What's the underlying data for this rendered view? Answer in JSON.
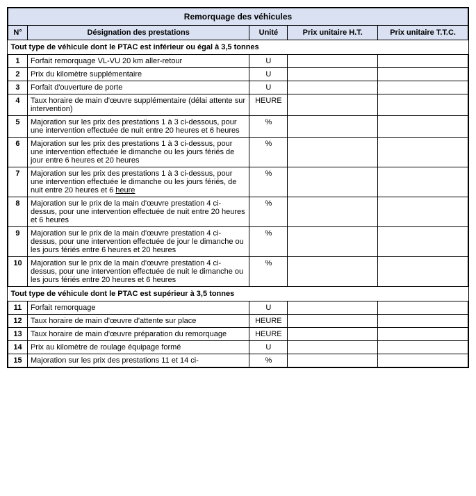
{
  "title": "Remorquage des véhicules",
  "columns": {
    "num": "N°",
    "designation": "Désignation des prestations",
    "unite": "Unité",
    "ht": "Prix unitaire H.T.",
    "ttc": "Prix unitaire T.T.C."
  },
  "section1": "Tout type de véhicule dont le PTAC est inférieur ou égal à 3,5 tonnes",
  "section2": "Tout type de véhicule dont le PTAC est supérieur à 3,5 tonnes",
  "rows": [
    {
      "num": "1",
      "desc": "Forfait remorquage VL-VU 20 km aller-retour",
      "unit": "U",
      "has_underline": false
    },
    {
      "num": "2",
      "desc": "Prix du kilomètre supplémentaire",
      "unit": "U",
      "has_underline": false
    },
    {
      "num": "3",
      "desc": "Forfait d'ouverture de porte",
      "unit": "U",
      "has_underline": false
    },
    {
      "num": "4",
      "desc": "Taux horaire de main d'œuvre supplémentaire (délai attente sur intervention)",
      "unit": "HEURE",
      "has_underline": false
    },
    {
      "num": "5",
      "desc": "Majoration sur les prix des prestations 1 à 3 ci-dessous, pour une intervention effectuée de nuit entre 20 heures et 6 heures",
      "unit": "%",
      "has_underline": false
    },
    {
      "num": "6",
      "desc": "Majoration sur les prix des prestations 1 à 3 ci-dessus, pour une intervention effectuée le dimanche ou les jours fériés de jour entre 6 heures et 20 heures",
      "unit": "%",
      "has_underline": false
    },
    {
      "num": "7",
      "desc": "Majoration sur les prix des prestations 1 à 3 ci-dessus, pour une intervention effectuée le dimanche ou les jours fériés, de nuit entre 20 heures et 6 heure",
      "unit": "%",
      "has_underline": true,
      "underline_word": "heure"
    },
    {
      "num": "8",
      "desc": "Majoration sur le prix de la main d'œuvre prestation 4 ci-dessus, pour une intervention effectuée de nuit entre 20 heures et 6 heures",
      "unit": "%",
      "has_underline": false
    },
    {
      "num": "9",
      "desc": "Majoration sur le prix de la main d'œuvre prestation 4 ci-dessus, pour une intervention effectuée de jour le dimanche ou les jours fériés entre 6 heures et 20 heures",
      "unit": "%",
      "has_underline": false
    },
    {
      "num": "10",
      "desc": "Majoration sur le prix de la main d'œuvre prestation 4 ci-dessus, pour une intervention effectuée de nuit le dimanche ou les jours fériés entre 20 heures et 6 heures",
      "unit": "%",
      "has_underline": false
    },
    {
      "num": "11",
      "desc": "Forfait remorquage",
      "unit": "U",
      "has_underline": false
    },
    {
      "num": "12",
      "desc": "Taux horaire de main d'œuvre d'attente sur place",
      "unit": "HEURE",
      "has_underline": false
    },
    {
      "num": "13",
      "desc": "Taux horaire de main d'œuvre préparation du remorquage",
      "unit": "HEURE",
      "has_underline": false
    },
    {
      "num": "14",
      "desc": "Prix au kilomètre de roulage équipage formé",
      "unit": "U",
      "has_underline": false
    },
    {
      "num": "15",
      "desc": "Majoration sur les prix des prestations 11 et 14 ci-",
      "unit": "%",
      "has_underline": false
    }
  ]
}
